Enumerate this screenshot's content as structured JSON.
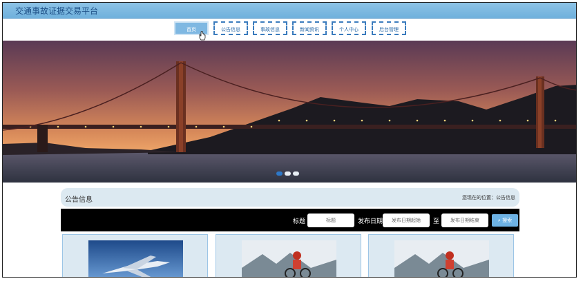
{
  "app": {
    "title": "交通事故证据交易平台"
  },
  "nav": {
    "items": [
      {
        "label": "首页",
        "active": true
      },
      {
        "label": "公告信息",
        "active": false
      },
      {
        "label": "事故信息",
        "active": false
      },
      {
        "label": "新闻资讯",
        "active": false
      },
      {
        "label": "个人中心",
        "active": false
      },
      {
        "label": "后台管理",
        "active": false
      }
    ]
  },
  "banner": {
    "slide_count": 3,
    "active_slide": 1
  },
  "notice": {
    "section_title": "公告信息",
    "breadcrumb": "您现在的位置：公告信息",
    "search": {
      "title_label": "标题",
      "title_placeholder": "标题",
      "date_label": "发布日期",
      "start_placeholder": "发布日期起始",
      "to_label": "至",
      "end_placeholder": "发布日期结束",
      "search_button": "搜索"
    }
  },
  "cards": [
    {
      "image": "airplane"
    },
    {
      "image": "cyclist"
    },
    {
      "image": "cyclist"
    }
  ],
  "colors": {
    "accent": "#3a7bbd",
    "header": "#7fb8e2"
  }
}
